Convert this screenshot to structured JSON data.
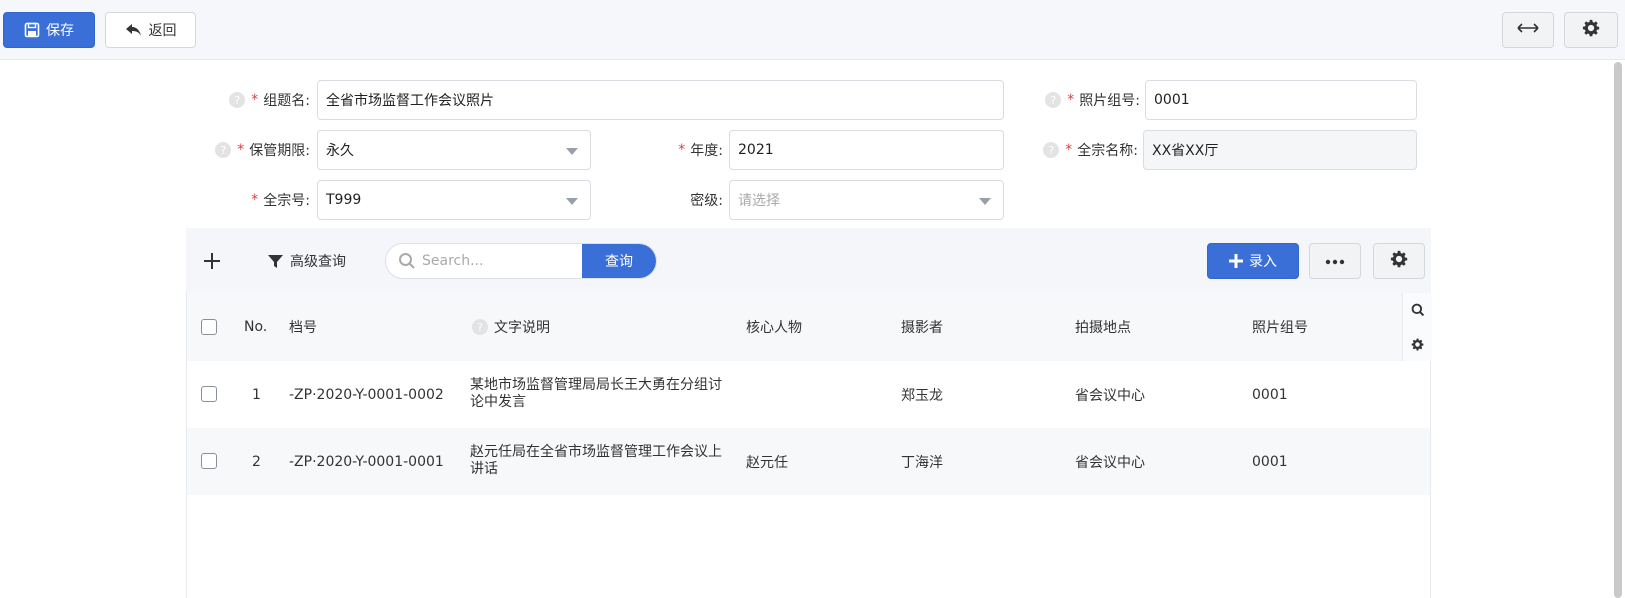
{
  "topbar": {
    "save_label": "保存",
    "back_label": "返回"
  },
  "form": {
    "topic_name": {
      "label": "组题名:",
      "value": "全省市场监督工作会议照片"
    },
    "photo_group_no": {
      "label": "照片组号:",
      "value": "0001"
    },
    "retention_period": {
      "label": "保管期限:",
      "value": "永久"
    },
    "year": {
      "label": "年度:",
      "value": "2021"
    },
    "fonds_name": {
      "label": "全宗名称:",
      "value": "XX省XX厅"
    },
    "fonds_no": {
      "label": "全宗号:",
      "value": "T999"
    },
    "security_level": {
      "label": "密级:",
      "placeholder": "请选择"
    }
  },
  "toolbar": {
    "advanced_search_label": "高级查询",
    "search_placeholder": "Search...",
    "search_button_label": "查询",
    "entry_button_label": "录入"
  },
  "table": {
    "columns": [
      "No.",
      "档号",
      "文字说明",
      "核心人物",
      "摄影者",
      "拍摄地点",
      "照片组号"
    ],
    "rows": [
      {
        "no": "1",
        "archive_no": "-ZP·2020-Y-0001-0002",
        "caption": "某地市场监督管理局局长王大勇在分组讨论中发言",
        "key_person": "",
        "photographer": "郑玉龙",
        "location": "省会议中心",
        "group_no": "0001"
      },
      {
        "no": "2",
        "archive_no": "-ZP·2020-Y-0001-0001",
        "caption": "赵元任局在全省市场监督管理工作会议上讲话",
        "key_person": "赵元任",
        "photographer": "丁海洋",
        "location": "省会议中心",
        "group_no": "0001"
      }
    ]
  },
  "colors": {
    "primary": "#3a6fd8",
    "required": "#e23c3c"
  }
}
